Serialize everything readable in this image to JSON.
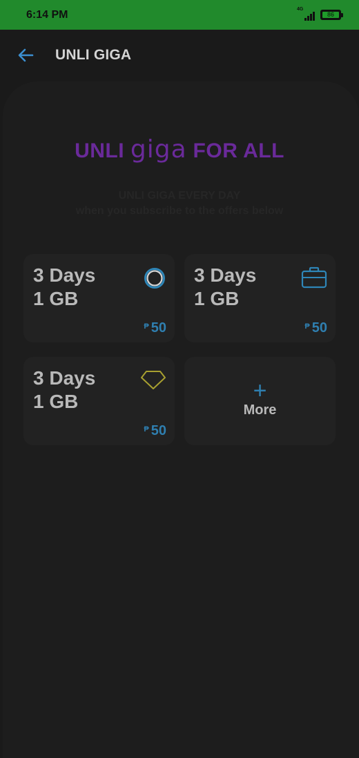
{
  "status": {
    "time": "6:14 PM",
    "network": "4G",
    "battery": "86"
  },
  "appbar": {
    "title": "UNLI GIGA",
    "back_icon": "arrow-left-icon"
  },
  "brand": {
    "part1": "UNLI",
    "part2": "giga",
    "part3": "FOR ALL",
    "color": "#6a2a9a"
  },
  "subtitle": {
    "line1": "UNLI GIGA EVERY DAY",
    "line2": "when you subscribe to the offers below"
  },
  "offers": [
    {
      "days": "3 Days",
      "data": "1 GB",
      "currency": "₱",
      "price": "50",
      "icon": "circle-ring-icon"
    },
    {
      "days": "3 Days",
      "data": "1 GB",
      "currency": "₱",
      "price": "50",
      "icon": "briefcase-icon"
    },
    {
      "days": "3 Days",
      "data": "1 GB",
      "currency": "₱",
      "price": "50",
      "icon": "diamond-icon"
    }
  ],
  "more": {
    "plus": "+",
    "label": "More"
  },
  "colors": {
    "status_bar": "#218a2c",
    "accent": "#2f7fb0",
    "brand": "#6a2a9a"
  }
}
